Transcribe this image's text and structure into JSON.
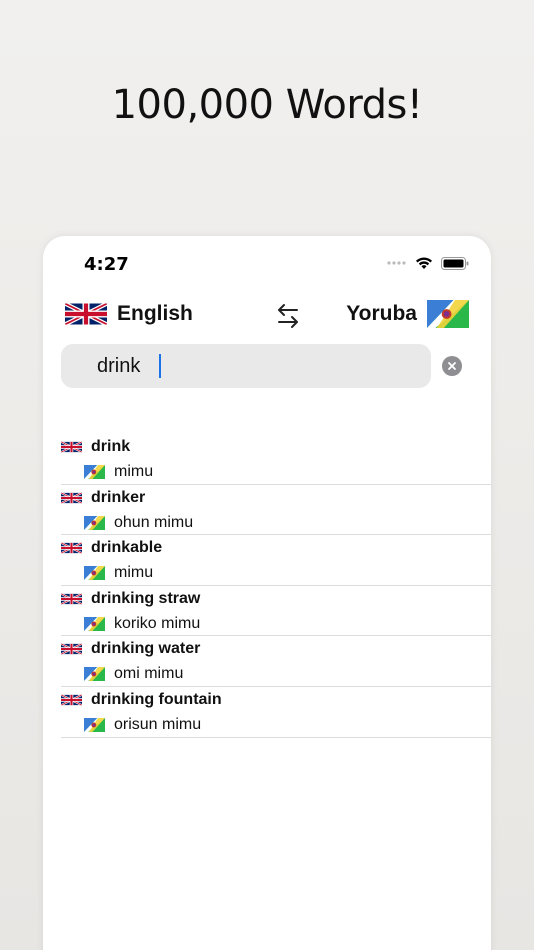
{
  "headline": "100,000 Words!",
  "status_bar": {
    "time": "4:27"
  },
  "languages": {
    "source": "English",
    "target": "Yoruba"
  },
  "search": {
    "value": "drink"
  },
  "results": [
    {
      "english": "drink",
      "yoruba": "mimu"
    },
    {
      "english": "drinker",
      "yoruba": "ohun mimu"
    },
    {
      "english": "drinkable",
      "yoruba": "mimu"
    },
    {
      "english": "drinking straw",
      "yoruba": "koriko mimu"
    },
    {
      "english": "drinking water",
      "yoruba": "omi mimu"
    },
    {
      "english": "drinking fountain",
      "yoruba": "orisun mimu"
    }
  ],
  "icons": {
    "swap": "swap-arrows-icon",
    "clear": "clear-search-icon",
    "wifi": "wifi-icon",
    "battery": "battery-icon",
    "signal": "signal-icon"
  },
  "colors": {
    "accent": "#1a73e8",
    "search_bg": "#e9e9ea"
  }
}
